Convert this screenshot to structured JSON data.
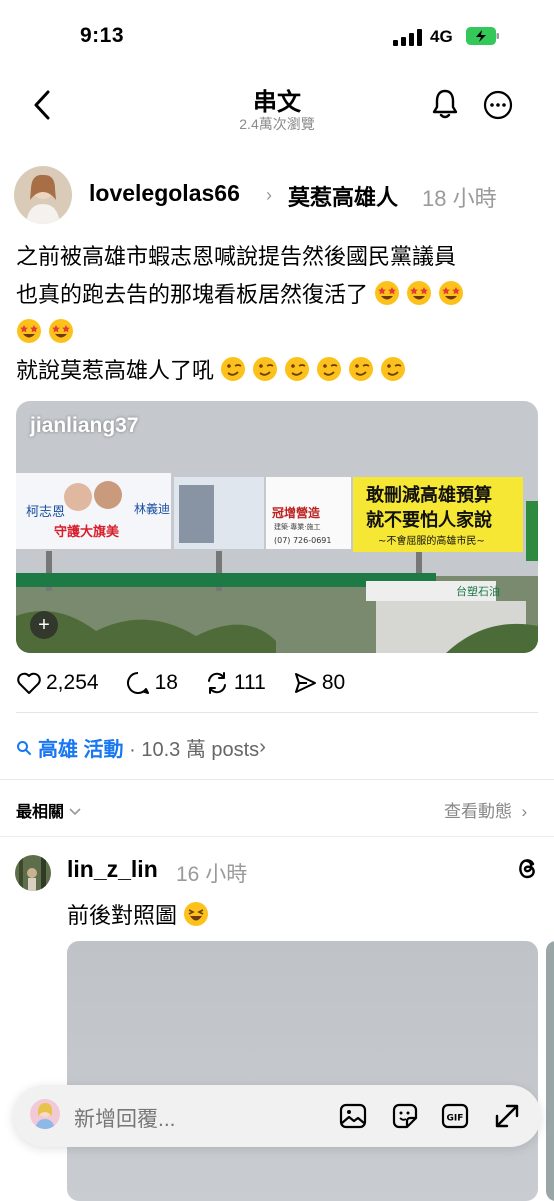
{
  "status_bar": {
    "time": "9:13",
    "network": "4G"
  },
  "header": {
    "title": "串文",
    "views": "2.4萬次瀏覽"
  },
  "post": {
    "username": "lovelegolas66",
    "community": "莫惹高雄人",
    "time": "18 小時",
    "line1": "之前被高雄市蝦志恩喊說提告然後國民黨議員",
    "line2": "也真的跑去告的那塊看板居然復活了",
    "line4": "就說莫惹高雄人了吼",
    "image_tag": "jianliang37",
    "billboard": {
      "left_name1": "柯志恩",
      "left_name2": "林義迪",
      "left_slogan": "守護大旗美",
      "mid_brand": "冠增營造",
      "mid_sub": "建築·專業·施工",
      "mid_phone": "(07) 726-0691",
      "right_line1": "敢刪減高雄預算",
      "right_line2": "就不要怕人家說",
      "right_line3": "~不會屈服的高雄市民~",
      "station": "台塑石油"
    },
    "likes": "2,254",
    "comments": "18",
    "reposts": "111",
    "shares": "80"
  },
  "topic": {
    "name": "高雄 活動",
    "count": "· 10.3 萬 posts",
    "chevron": "›"
  },
  "filters": {
    "sort_label": "最相關",
    "activity_label": "查看動態",
    "chevron": "›"
  },
  "reply": {
    "username": "lin_z_lin",
    "time": "16 小時",
    "text": "前後對照圖"
  },
  "reply_bar": {
    "placeholder": "新增回覆..."
  },
  "icons": [
    "back-icon",
    "bell-icon",
    "more-icon",
    "heart-icon",
    "comment-icon",
    "repost-icon",
    "share-icon",
    "search-icon",
    "threads-icon",
    "image-icon",
    "sticker-icon",
    "gif-icon",
    "expand-icon"
  ],
  "colors": {
    "accent": "#1877f2",
    "muted": "#9a9a9a",
    "battery": "#34c759"
  }
}
